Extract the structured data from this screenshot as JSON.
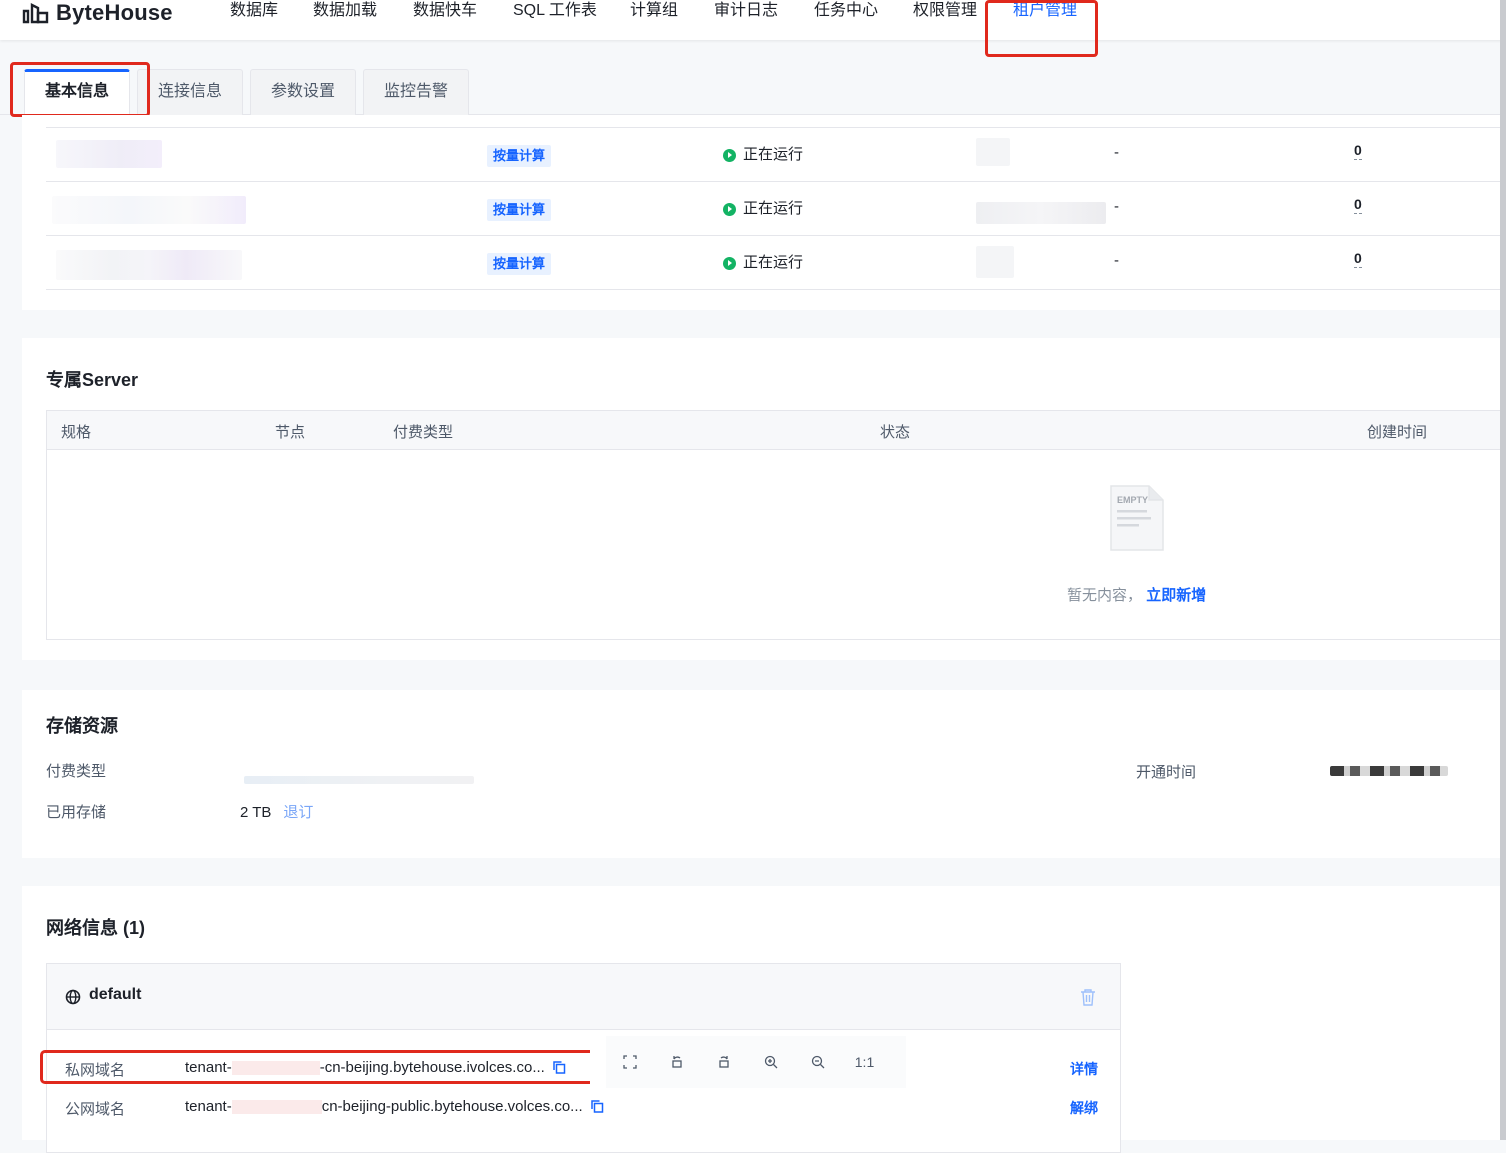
{
  "app": {
    "logo_text": "ByteHouse"
  },
  "nav": {
    "items": [
      "数据库",
      "数据加载",
      "数据快车",
      "SQL 工作表",
      "计算组",
      "审计日志",
      "任务中心",
      "权限管理",
      "租户管理"
    ],
    "active_index": 8
  },
  "tabs": [
    {
      "label": "基本信息",
      "active": true
    },
    {
      "label": "连接信息",
      "active": false
    },
    {
      "label": "参数设置",
      "active": false
    },
    {
      "label": "监控告警",
      "active": false
    }
  ],
  "compute": {
    "rows": [
      {
        "billing": "按量计算",
        "status": "正在运行",
        "col5": "-",
        "count": "0"
      },
      {
        "billing": "按量计算",
        "status": "正在运行",
        "col5": "-",
        "count": "0"
      },
      {
        "billing": "按量计算",
        "status": "正在运行",
        "col5": "-",
        "count": "0"
      }
    ]
  },
  "server": {
    "title": "专属Server",
    "columns": [
      "规格",
      "节点",
      "付费类型",
      "状态",
      "创建时间"
    ],
    "empty_text": "暂无内容，",
    "empty_link": "立即新增",
    "empty_icon_text": "EMPTY"
  },
  "storage": {
    "title": "存储资源",
    "billing_label": "付费类型",
    "used_label": "已用存储",
    "used_value": "2 TB",
    "unsubscribe": "退订",
    "open_time_label": "开通时间"
  },
  "network": {
    "title": "网络信息 (1)",
    "name": "default",
    "private_label": "私网域名",
    "private_prefix": "tenant-",
    "private_suffix": "-cn-beijing.bytehouse.ivolces.co...",
    "public_label": "公网域名",
    "public_prefix": "tenant-",
    "public_suffix": "cn-beijing-public.bytehouse.volces.co...",
    "details_link": "详情",
    "unbind_link": "解绑"
  },
  "viewer_toolbar": {
    "actual_size": "1:1"
  }
}
